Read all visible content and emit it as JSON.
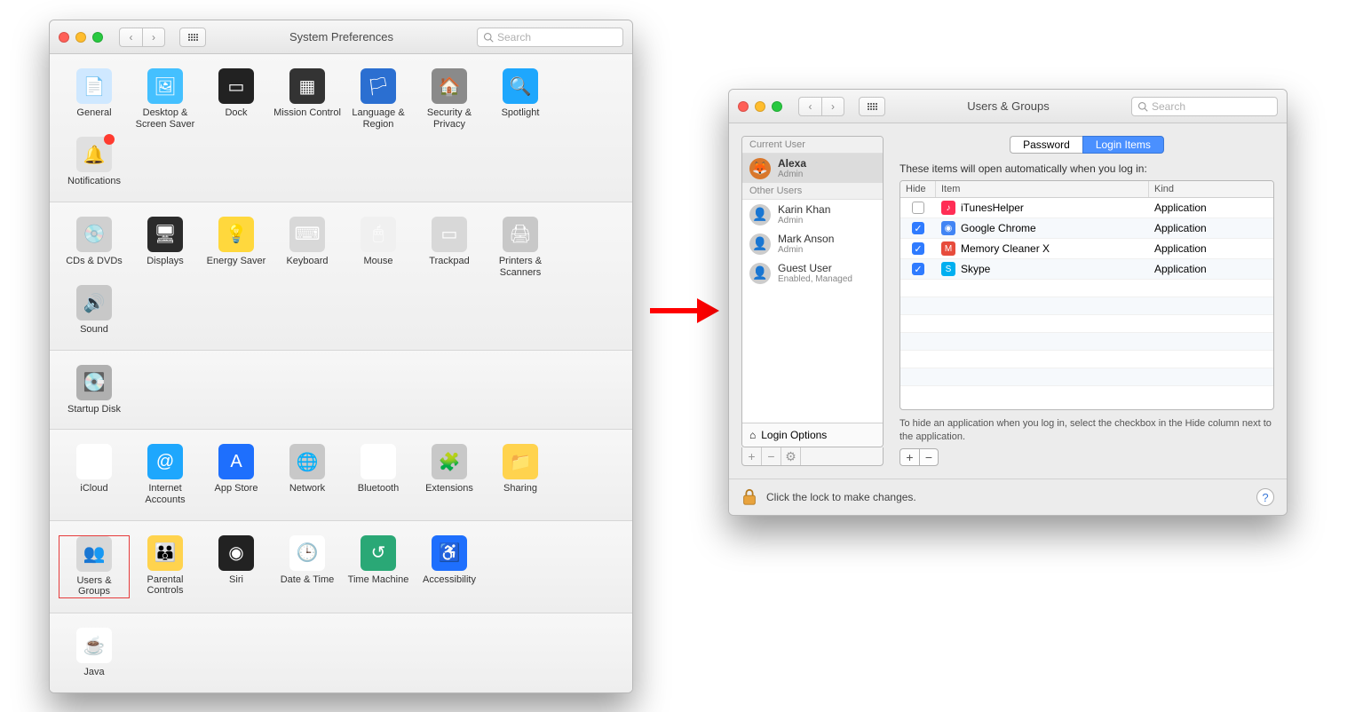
{
  "prefs": {
    "title": "System Preferences",
    "search_placeholder": "Search",
    "sections": [
      [
        "General",
        "Desktop & Screen Saver",
        "Dock",
        "Mission Control",
        "Language & Region",
        "Security & Privacy",
        "Spotlight",
        "Notifications"
      ],
      [
        "CDs & DVDs",
        "Displays",
        "Energy Saver",
        "Keyboard",
        "Mouse",
        "Trackpad",
        "Printers & Scanners",
        "Sound"
      ],
      [
        "Startup Disk"
      ],
      [
        "iCloud",
        "Internet Accounts",
        "App Store",
        "Network",
        "Bluetooth",
        "Extensions",
        "Sharing"
      ],
      [
        "Users & Groups",
        "Parental Controls",
        "Siri",
        "Date & Time",
        "Time Machine",
        "Accessibility"
      ],
      [
        "Java"
      ]
    ]
  },
  "ug": {
    "title": "Users & Groups",
    "search_placeholder": "Search",
    "current_user_label": "Current User",
    "other_users_label": "Other Users",
    "current_user": {
      "name": "Alexa",
      "role": "Admin"
    },
    "other_users": [
      {
        "name": "Karin Khan",
        "role": "Admin"
      },
      {
        "name": "Mark Anson",
        "role": "Admin"
      },
      {
        "name": "Guest User",
        "role": "Enabled, Managed"
      }
    ],
    "login_options_label": "Login Options",
    "tabs": {
      "password": "Password",
      "login_items": "Login Items"
    },
    "auto_open_text": "These items will open automatically when you log in:",
    "columns": {
      "hide": "Hide",
      "item": "Item",
      "kind": "Kind"
    },
    "items": [
      {
        "hidden": false,
        "name": "iTunesHelper",
        "kind": "Application",
        "color": "#ff2d55",
        "glyph": "♪"
      },
      {
        "hidden": true,
        "name": "Google Chrome",
        "kind": "Application",
        "color": "#4285f4",
        "glyph": "◉"
      },
      {
        "hidden": true,
        "name": "Memory Cleaner X",
        "kind": "Application",
        "color": "#e74c3c",
        "glyph": "M"
      },
      {
        "hidden": true,
        "name": "Skype",
        "kind": "Application",
        "color": "#00aff0",
        "glyph": "S"
      }
    ],
    "hint": "To hide an application when you log in, select the checkbox in the Hide column next to the application.",
    "lock_text": "Click the lock to make changes."
  },
  "icons": {
    "General": {
      "bg": "#cfe8ff",
      "glyph": "📄"
    },
    "Desktop & Screen Saver": {
      "bg": "#44c0ff",
      "glyph": "🖼"
    },
    "Dock": {
      "bg": "#222",
      "glyph": "▭"
    },
    "Mission Control": {
      "bg": "#333",
      "glyph": "▦"
    },
    "Language & Region": {
      "bg": "#2b6fd1",
      "glyph": "🏳"
    },
    "Security & Privacy": {
      "bg": "#8a8a8a",
      "glyph": "🏠"
    },
    "Spotlight": {
      "bg": "#1ea7fd",
      "glyph": "🔍"
    },
    "Notifications": {
      "bg": "#e0e0e0",
      "glyph": "🔔"
    },
    "CDs & DVDs": {
      "bg": "#d0d0d0",
      "glyph": "💿"
    },
    "Displays": {
      "bg": "#2b2b2b",
      "glyph": "🖥"
    },
    "Energy Saver": {
      "bg": "#ffd83d",
      "glyph": "💡"
    },
    "Keyboard": {
      "bg": "#d8d8d8",
      "glyph": "⌨"
    },
    "Mouse": {
      "bg": "#f0f0f0",
      "glyph": "🖱"
    },
    "Trackpad": {
      "bg": "#d8d8d8",
      "glyph": "▭"
    },
    "Printers & Scanners": {
      "bg": "#c8c8c8",
      "glyph": "🖨"
    },
    "Sound": {
      "bg": "#c8c8c8",
      "glyph": "🔊"
    },
    "Startup Disk": {
      "bg": "#b0b0b0",
      "glyph": "💽"
    },
    "iCloud": {
      "bg": "#ffffff",
      "glyph": "☁"
    },
    "Internet Accounts": {
      "bg": "#1ea7fd",
      "glyph": "@"
    },
    "App Store": {
      "bg": "#1e6ffd",
      "glyph": "A"
    },
    "Network": {
      "bg": "#c8c8c8",
      "glyph": "🌐"
    },
    "Bluetooth": {
      "bg": "#ffffff",
      "glyph": "ᚼ"
    },
    "Extensions": {
      "bg": "#c8c8c8",
      "glyph": "🧩"
    },
    "Sharing": {
      "bg": "#ffd34e",
      "glyph": "📁"
    },
    "Users & Groups": {
      "bg": "#d8d8d8",
      "glyph": "👥"
    },
    "Parental Controls": {
      "bg": "#ffd34e",
      "glyph": "👪"
    },
    "Siri": {
      "bg": "#222",
      "glyph": "◉"
    },
    "Date & Time": {
      "bg": "#ffffff",
      "glyph": "🕒"
    },
    "Time Machine": {
      "bg": "#2aa876",
      "glyph": "↺"
    },
    "Accessibility": {
      "bg": "#1e6ffd",
      "glyph": "♿"
    },
    "Java": {
      "bg": "#ffffff",
      "glyph": "☕"
    }
  }
}
